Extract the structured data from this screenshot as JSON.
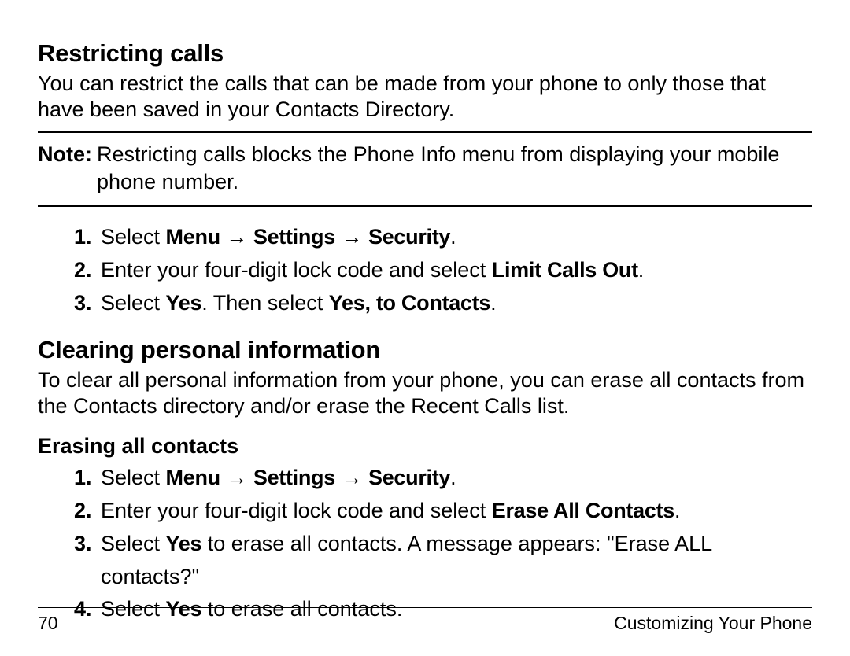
{
  "section1": {
    "heading": "Restricting calls",
    "intro": "You can restrict the calls that can be made from your phone to only those that have been saved in your Contacts Directory.",
    "note_label": "Note:",
    "note_text": "Restricting calls blocks the Phone Info menu from displaying your mobile phone number.",
    "steps": [
      {
        "pre": "Select ",
        "bold1": "Menu",
        "arr1": " → ",
        "bold2": "Settings",
        "arr2": " → ",
        "bold3": "Security",
        "post": "."
      },
      {
        "pre": "Enter your four-digit lock code and select ",
        "bold1": "Limit Calls Out",
        "post": "."
      },
      {
        "pre": "Select ",
        "bold1": "Yes",
        "mid": ". Then select ",
        "bold2": "Yes, to Contacts",
        "post": "."
      }
    ]
  },
  "section2": {
    "heading": "Clearing personal information",
    "intro": "To clear all personal information from your phone, you can erase all contacts from the Contacts directory and/or erase the Recent Calls list.",
    "subheading": "Erasing all contacts",
    "steps": [
      {
        "pre": "Select ",
        "bold1": "Menu",
        "arr1": " → ",
        "bold2": "Settings",
        "arr2": " → ",
        "bold3": "Security",
        "post": "."
      },
      {
        "pre": "Enter your four-digit lock code and select ",
        "bold1": "Erase All Contacts",
        "post": "."
      },
      {
        "pre": "Select ",
        "bold1": "Yes",
        "mid": " to erase all contacts. A message appears: \"Erase ALL contacts?\"",
        "post": ""
      },
      {
        "pre": "Select ",
        "bold1": "Yes",
        "mid": " to erase all contacts.",
        "post": ""
      }
    ]
  },
  "footer": {
    "page_number": "70",
    "chapter": "Customizing Your Phone"
  }
}
